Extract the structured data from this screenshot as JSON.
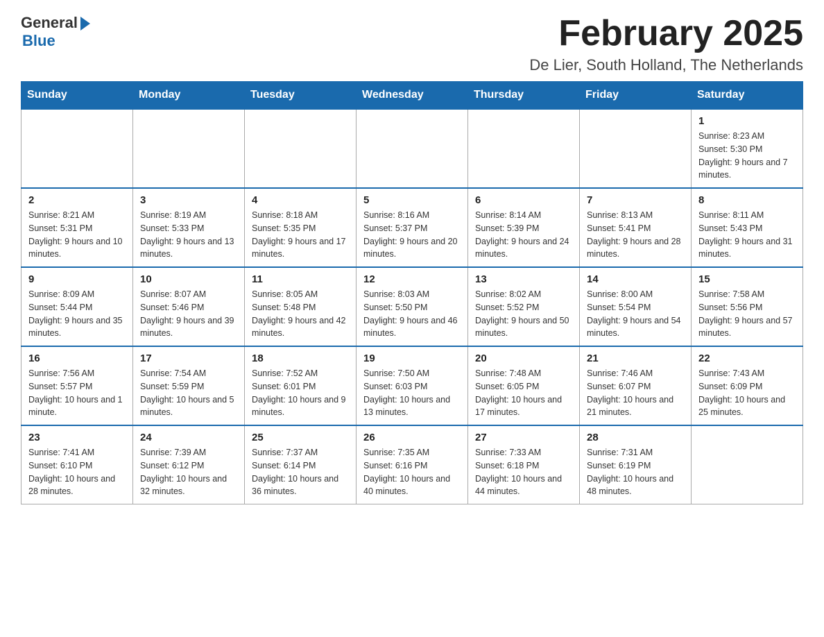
{
  "header": {
    "logo_general": "General",
    "logo_blue": "Blue",
    "month_title": "February 2025",
    "location": "De Lier, South Holland, The Netherlands"
  },
  "days_of_week": [
    "Sunday",
    "Monday",
    "Tuesday",
    "Wednesday",
    "Thursday",
    "Friday",
    "Saturday"
  ],
  "weeks": [
    [
      {
        "day": "",
        "info": ""
      },
      {
        "day": "",
        "info": ""
      },
      {
        "day": "",
        "info": ""
      },
      {
        "day": "",
        "info": ""
      },
      {
        "day": "",
        "info": ""
      },
      {
        "day": "",
        "info": ""
      },
      {
        "day": "1",
        "info": "Sunrise: 8:23 AM\nSunset: 5:30 PM\nDaylight: 9 hours and 7 minutes."
      }
    ],
    [
      {
        "day": "2",
        "info": "Sunrise: 8:21 AM\nSunset: 5:31 PM\nDaylight: 9 hours and 10 minutes."
      },
      {
        "day": "3",
        "info": "Sunrise: 8:19 AM\nSunset: 5:33 PM\nDaylight: 9 hours and 13 minutes."
      },
      {
        "day": "4",
        "info": "Sunrise: 8:18 AM\nSunset: 5:35 PM\nDaylight: 9 hours and 17 minutes."
      },
      {
        "day": "5",
        "info": "Sunrise: 8:16 AM\nSunset: 5:37 PM\nDaylight: 9 hours and 20 minutes."
      },
      {
        "day": "6",
        "info": "Sunrise: 8:14 AM\nSunset: 5:39 PM\nDaylight: 9 hours and 24 minutes."
      },
      {
        "day": "7",
        "info": "Sunrise: 8:13 AM\nSunset: 5:41 PM\nDaylight: 9 hours and 28 minutes."
      },
      {
        "day": "8",
        "info": "Sunrise: 8:11 AM\nSunset: 5:43 PM\nDaylight: 9 hours and 31 minutes."
      }
    ],
    [
      {
        "day": "9",
        "info": "Sunrise: 8:09 AM\nSunset: 5:44 PM\nDaylight: 9 hours and 35 minutes."
      },
      {
        "day": "10",
        "info": "Sunrise: 8:07 AM\nSunset: 5:46 PM\nDaylight: 9 hours and 39 minutes."
      },
      {
        "day": "11",
        "info": "Sunrise: 8:05 AM\nSunset: 5:48 PM\nDaylight: 9 hours and 42 minutes."
      },
      {
        "day": "12",
        "info": "Sunrise: 8:03 AM\nSunset: 5:50 PM\nDaylight: 9 hours and 46 minutes."
      },
      {
        "day": "13",
        "info": "Sunrise: 8:02 AM\nSunset: 5:52 PM\nDaylight: 9 hours and 50 minutes."
      },
      {
        "day": "14",
        "info": "Sunrise: 8:00 AM\nSunset: 5:54 PM\nDaylight: 9 hours and 54 minutes."
      },
      {
        "day": "15",
        "info": "Sunrise: 7:58 AM\nSunset: 5:56 PM\nDaylight: 9 hours and 57 minutes."
      }
    ],
    [
      {
        "day": "16",
        "info": "Sunrise: 7:56 AM\nSunset: 5:57 PM\nDaylight: 10 hours and 1 minute."
      },
      {
        "day": "17",
        "info": "Sunrise: 7:54 AM\nSunset: 5:59 PM\nDaylight: 10 hours and 5 minutes."
      },
      {
        "day": "18",
        "info": "Sunrise: 7:52 AM\nSunset: 6:01 PM\nDaylight: 10 hours and 9 minutes."
      },
      {
        "day": "19",
        "info": "Sunrise: 7:50 AM\nSunset: 6:03 PM\nDaylight: 10 hours and 13 minutes."
      },
      {
        "day": "20",
        "info": "Sunrise: 7:48 AM\nSunset: 6:05 PM\nDaylight: 10 hours and 17 minutes."
      },
      {
        "day": "21",
        "info": "Sunrise: 7:46 AM\nSunset: 6:07 PM\nDaylight: 10 hours and 21 minutes."
      },
      {
        "day": "22",
        "info": "Sunrise: 7:43 AM\nSunset: 6:09 PM\nDaylight: 10 hours and 25 minutes."
      }
    ],
    [
      {
        "day": "23",
        "info": "Sunrise: 7:41 AM\nSunset: 6:10 PM\nDaylight: 10 hours and 28 minutes."
      },
      {
        "day": "24",
        "info": "Sunrise: 7:39 AM\nSunset: 6:12 PM\nDaylight: 10 hours and 32 minutes."
      },
      {
        "day": "25",
        "info": "Sunrise: 7:37 AM\nSunset: 6:14 PM\nDaylight: 10 hours and 36 minutes."
      },
      {
        "day": "26",
        "info": "Sunrise: 7:35 AM\nSunset: 6:16 PM\nDaylight: 10 hours and 40 minutes."
      },
      {
        "day": "27",
        "info": "Sunrise: 7:33 AM\nSunset: 6:18 PM\nDaylight: 10 hours and 44 minutes."
      },
      {
        "day": "28",
        "info": "Sunrise: 7:31 AM\nSunset: 6:19 PM\nDaylight: 10 hours and 48 minutes."
      },
      {
        "day": "",
        "info": ""
      }
    ]
  ]
}
